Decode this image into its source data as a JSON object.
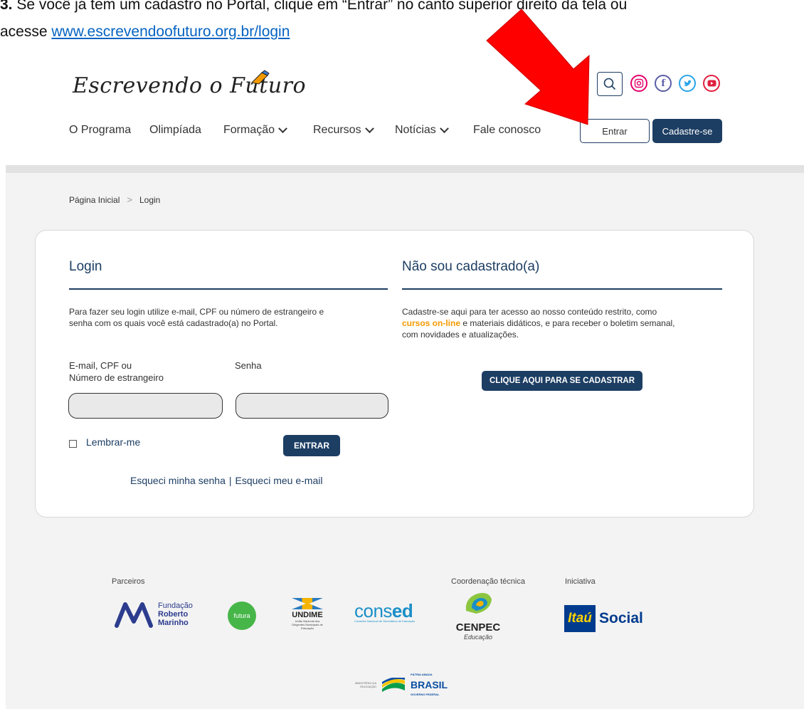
{
  "instruction": {
    "number": "3.",
    "text": " Se você já tem um cadastro no Portal, clique em “Entrar” no canto superior direito da tela ou",
    "link_prefix": "acesse ",
    "link": "www.escrevendoofuturo.org.br/login"
  },
  "header": {
    "logo_text": "Escrevendo o Futuro",
    "nav": [
      {
        "label": "O Programa",
        "dropdown": false
      },
      {
        "label": "Olimpíada",
        "dropdown": false
      },
      {
        "label": "Formação",
        "dropdown": true
      },
      {
        "label": "Recursos",
        "dropdown": true
      },
      {
        "label": "Notícias",
        "dropdown": true
      },
      {
        "label": "Fale conosco",
        "dropdown": false
      }
    ],
    "entrar_label": "Entrar",
    "cadastre_label": "Cadastre-se",
    "social_icons": [
      "instagram-icon",
      "facebook-icon",
      "twitter-icon",
      "youtube-icon"
    ]
  },
  "breadcrumb": {
    "home": "Página Inicial",
    "separator": ">",
    "current": "Login"
  },
  "login": {
    "title": "Login",
    "description_line1": "Para fazer seu login utilize e-mail, CPF ou número de estrangeiro e",
    "description_line2": "senha com os quais você está cadastrado(a) no Portal.",
    "email_label_line1": "E-mail, CPF ou",
    "email_label_line2": "Número de estrangeiro",
    "password_label": "Senha",
    "remember_label": "Lembrar-me",
    "submit_label": "ENTRAR",
    "forgot_password": "Esqueci minha senha",
    "forgot_separator": "|",
    "forgot_email": "Esqueci meu e-mail"
  },
  "register": {
    "title": "Não sou cadastrado(a)",
    "line1": "Cadastre-se aqui para ter acesso ao nosso conteúdo restrito, como",
    "highlight": "cursos on-line",
    "line2_rest": " e materiais didáticos, e para receber o boletim semanal,",
    "line3": "com novidades e atualizações.",
    "button_label": "CLIQUE AQUI PARA SE CADASTRAR"
  },
  "footer": {
    "partners_label": "Parceiros",
    "coordination_label": "Coordenação técnica",
    "initiative_label": "Iniciativa",
    "frm": {
      "line1": "Fundação",
      "line2": "Roberto",
      "line3": "Marinho"
    },
    "futura": "futura",
    "undime": {
      "name": "UNDIME",
      "sub": "União Nacional dos Dirigentes Municipais de Educação"
    },
    "consed": {
      "name_a": "cons",
      "name_b": "ed",
      "sub": "Conselho Nacional de Secretários de Educação"
    },
    "cenpec": {
      "name": "CENPEC",
      "sub": "Educação"
    },
    "itau": {
      "box": "Itaú",
      "name": "Social"
    },
    "gov": {
      "mec": "MINISTÉRIO DA EDUCAÇÃO",
      "top": "PÁTRIA AMADA",
      "brasil": "BRASIL",
      "bottom": "GOVERNO FEDERAL"
    }
  },
  "colors": {
    "brand_navy": "#1d3e63",
    "highlight_orange": "#f39a00",
    "arrow_red": "#ff0000"
  }
}
